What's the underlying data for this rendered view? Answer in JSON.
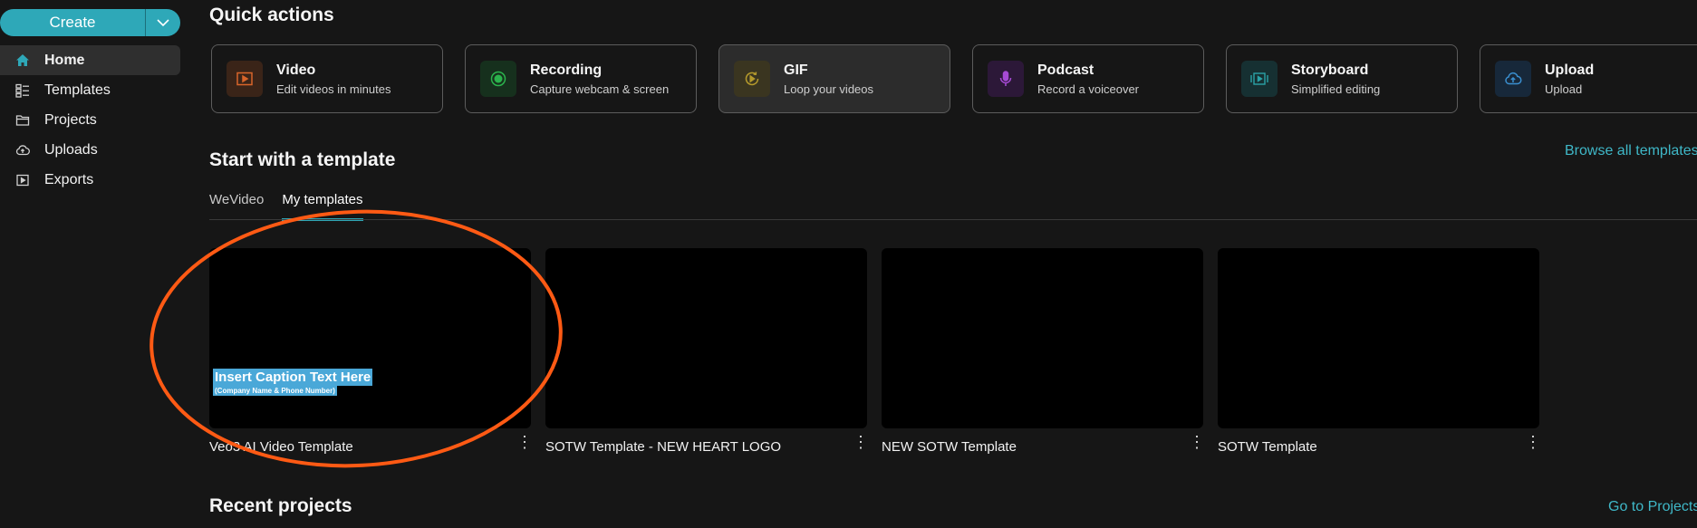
{
  "sidebar": {
    "create_label": "Create",
    "items": [
      {
        "label": "Home",
        "icon": "home-icon",
        "active": true
      },
      {
        "label": "Templates",
        "icon": "templates-icon"
      },
      {
        "label": "Projects",
        "icon": "folder-icon"
      },
      {
        "label": "Uploads",
        "icon": "cloud-upload-icon"
      },
      {
        "label": "Exports",
        "icon": "export-icon"
      }
    ]
  },
  "quick_actions": {
    "title": "Quick actions",
    "cards": [
      {
        "title": "Video",
        "subtitle": "Edit videos in minutes",
        "icon": "video-icon",
        "color": "#d8652a"
      },
      {
        "title": "Recording",
        "subtitle": "Capture webcam & screen",
        "icon": "record-icon",
        "color": "#2bb24c"
      },
      {
        "title": "GIF",
        "subtitle": "Loop your videos",
        "icon": "gif-icon",
        "color": "#b59a2c"
      },
      {
        "title": "Podcast",
        "subtitle": "Record a voiceover",
        "icon": "microphone-icon",
        "color": "#a64ad4"
      },
      {
        "title": "Storyboard",
        "subtitle": "Simplified editing",
        "icon": "storyboard-icon",
        "color": "#2aa3a8"
      },
      {
        "title": "Upload",
        "subtitle": "Upload",
        "icon": "cloud-upload-icon",
        "color": "#3a8fd0"
      }
    ]
  },
  "templates": {
    "title": "Start with a template",
    "browse_link": "Browse all templates",
    "tabs": [
      {
        "label": "WeVideo"
      },
      {
        "label": "My templates",
        "active": true
      }
    ],
    "items": [
      {
        "name": "Veo3 AI Video Template",
        "caption": "Insert Caption Text Here",
        "caption_sub": "(Company Name & Phone Number)"
      },
      {
        "name": "SOTW Template - NEW HEART LOGO"
      },
      {
        "name": "NEW SOTW Template"
      },
      {
        "name": "SOTW Template"
      }
    ]
  },
  "recent": {
    "title": "Recent projects",
    "goto_link": "Go to Projects"
  },
  "colors": {
    "accent": "#2ea8b8",
    "link": "#3fb8c8",
    "annotation": "#ff5a14",
    "background": "#161616"
  }
}
